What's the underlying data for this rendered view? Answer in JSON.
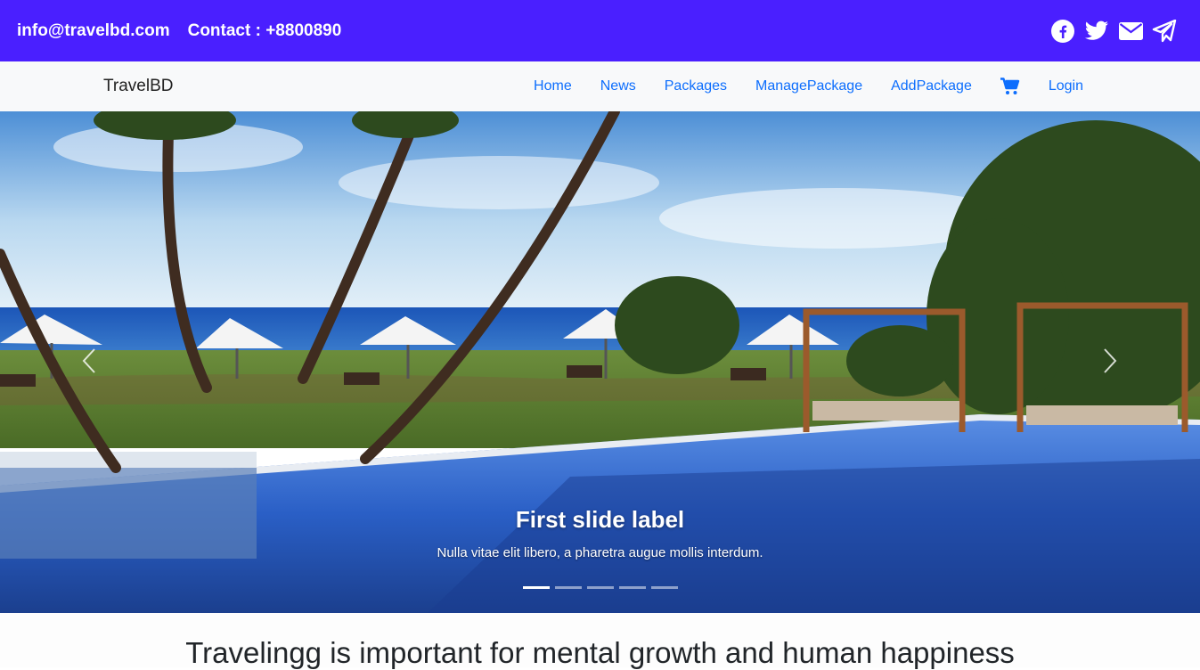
{
  "topbar": {
    "email": "info@travelbd.com",
    "contact": "Contact : +8800890",
    "social_icons": [
      "facebook-icon",
      "twitter-icon",
      "envelope-icon",
      "telegram-icon"
    ],
    "background": "#4a1fff"
  },
  "navbar": {
    "brand": "TravelBD",
    "links": [
      {
        "label": "Home"
      },
      {
        "label": "News"
      },
      {
        "label": "Packages"
      },
      {
        "label": "ManagePackage"
      },
      {
        "label": "AddPackage"
      }
    ],
    "cart_icon": "cart-icon",
    "login": "Login",
    "link_color": "#0d6efd"
  },
  "carousel": {
    "caption_label": "First slide label",
    "caption_text": "Nulla vitae elit libero, a pharetra augue mollis interdum.",
    "slide_count": 5,
    "active_slide": 1
  },
  "headline": {
    "text": "Travelingg is important for mental growth and human happiness"
  }
}
